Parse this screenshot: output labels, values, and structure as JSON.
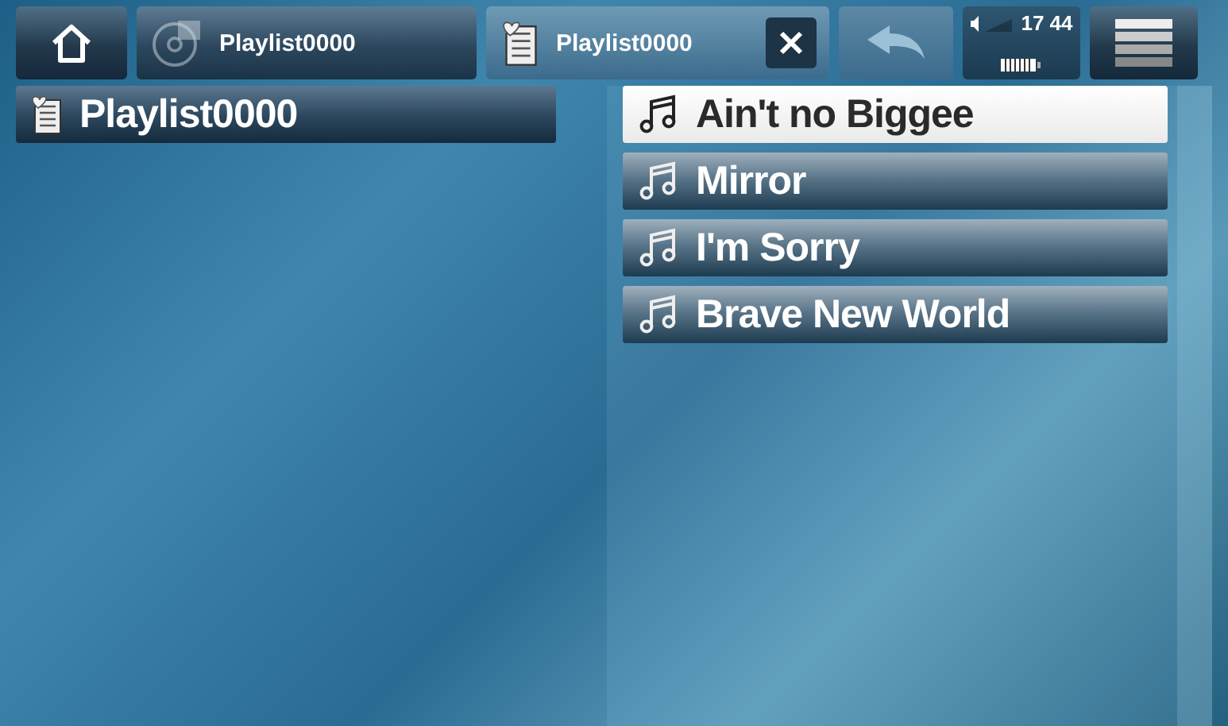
{
  "toolbar": {
    "tabs": [
      {
        "label": "Playlist0000",
        "kind": "disc",
        "selected": false
      },
      {
        "label": "Playlist0000",
        "kind": "playlist",
        "selected": true
      }
    ],
    "status": {
      "time": "17 44"
    }
  },
  "left_panel": {
    "title": "Playlist0000"
  },
  "tracks": [
    {
      "title": "Ain't no Biggee",
      "selected": true
    },
    {
      "title": "Mirror",
      "selected": false
    },
    {
      "title": "I'm Sorry",
      "selected": false
    },
    {
      "title": "Brave New World",
      "selected": false
    }
  ]
}
